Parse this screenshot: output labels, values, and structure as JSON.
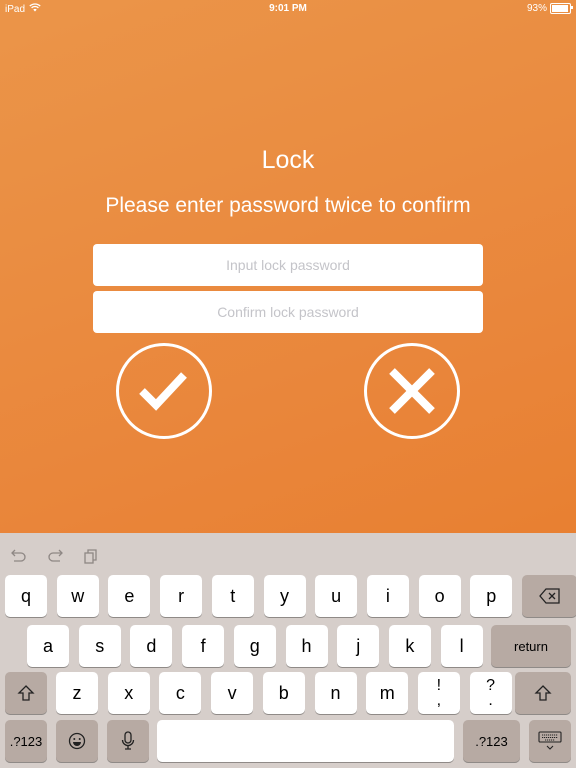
{
  "status_bar": {
    "device": "iPad",
    "time": "9:01 PM",
    "battery": "93%",
    "battery_level": 0.93
  },
  "lock": {
    "title": "Lock",
    "subtitle": "Please enter password twice to confirm",
    "password_field": {
      "value": "",
      "placeholder": "Input lock password"
    },
    "confirm_field": {
      "value": "",
      "placeholder": "Confirm lock password"
    },
    "confirm_button_icon": "checkmark-icon",
    "cancel_button_icon": "close-icon"
  },
  "keyboard": {
    "toolbar": [
      "undo-icon",
      "redo-icon",
      "paste-icon"
    ],
    "row1": [
      "q",
      "w",
      "e",
      "r",
      "t",
      "y",
      "u",
      "i",
      "o",
      "p"
    ],
    "row2": [
      "a",
      "s",
      "d",
      "f",
      "g",
      "h",
      "j",
      "k",
      "l"
    ],
    "row3": [
      "z",
      "x",
      "c",
      "v",
      "b",
      "n",
      "m"
    ],
    "punct1": {
      "top": "!",
      "bottom": ","
    },
    "punct2": {
      "top": "?",
      "bottom": "."
    },
    "return_label": "return",
    "numbers_label": ".?123",
    "space_label": ""
  },
  "colors": {
    "accent": "#e9853a",
    "caret": "#2f6cf6",
    "keyboard_bg": "#d6ceca",
    "dark_key": "#b7aaa3"
  }
}
